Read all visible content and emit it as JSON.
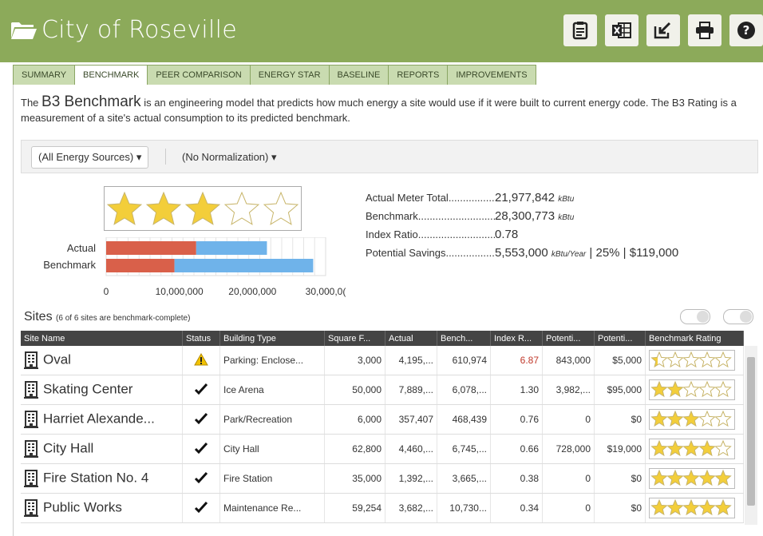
{
  "header": {
    "title": "City of Roseville",
    "buttons": [
      "notes-icon",
      "excel-icon",
      "export-icon",
      "print-icon",
      "help-icon"
    ]
  },
  "tabs": [
    "SUMMARY",
    "BENCHMARK",
    "PEER COMPARISON",
    "ENERGY STAR",
    "BASELINE",
    "REPORTS",
    "IMPROVEMENTS"
  ],
  "active_tab": "BENCHMARK",
  "intro": {
    "prefix": "The ",
    "emph": "B3 Benchmark",
    "text": " is an engineering model that predicts how much energy a site would use if it were built to current energy code. The B3 Rating is a measurement of a site's actual consumption to its predicted benchmark."
  },
  "filters": {
    "energy": "(All Energy Sources) ▾",
    "normalization": "(No Normalization) ▾"
  },
  "rating_stars": 3,
  "mini_chart": {
    "labels": [
      "Actual",
      "Benchmark"
    ],
    "ticks": [
      "0",
      "10,000,000",
      "20,000,000",
      "30,000,0("
    ],
    "actual": 21977842,
    "benchmark": 28300773,
    "colors": {
      "red": "#d9604a",
      "blue": "#6fb3ea"
    }
  },
  "stats": [
    {
      "label": "Actual Meter Total",
      "value": "21,977,842",
      "unit": "kBtu",
      "extra": ""
    },
    {
      "label": "Benchmark",
      "value": "28,300,773",
      "unit": "kBtu",
      "extra": ""
    },
    {
      "label": "Index Ratio",
      "value": "0.78",
      "unit": "",
      "extra": ""
    },
    {
      "label": "Potential Savings",
      "value": "5,553,000",
      "unit": "kBtu/Year",
      "extra": " | 25% | $119,000"
    }
  ],
  "sites": {
    "title": "Sites",
    "subtitle": "(6 of 6 sites are benchmark-complete)",
    "columns": [
      "Site Name",
      "Status",
      "Building Type",
      "Square F...",
      "Actual",
      "Bench...",
      "Index R...",
      "Potenti...",
      "Potenti...",
      "Benchmark Rating"
    ],
    "rows": [
      {
        "name": "Oval",
        "status": "warning",
        "type": "Parking: Enclose...",
        "sqft": "3,000",
        "actual": "4,195,...",
        "bench": "610,974",
        "index": "6.87",
        "pot_kbtu": "843,000",
        "pot_usd": "$5,000",
        "stars": 0.4,
        "highlight": true
      },
      {
        "name": "Skating Center",
        "status": "check",
        "type": "Ice Arena",
        "sqft": "50,000",
        "actual": "7,889,...",
        "bench": "6,078,...",
        "index": "1.30",
        "pot_kbtu": "3,982,...",
        "pot_usd": "$95,000",
        "stars": 2,
        "highlight": false
      },
      {
        "name": "Harriet Alexande...",
        "status": "check",
        "type": "Park/Recreation",
        "sqft": "6,000",
        "actual": "357,407",
        "bench": "468,439",
        "index": "0.76",
        "pot_kbtu": "0",
        "pot_usd": "$0",
        "stars": 3,
        "highlight": false
      },
      {
        "name": "City Hall",
        "status": "check",
        "type": "City Hall",
        "sqft": "62,800",
        "actual": "4,460,...",
        "bench": "6,745,...",
        "index": "0.66",
        "pot_kbtu": "728,000",
        "pot_usd": "$19,000",
        "stars": 4,
        "highlight": false
      },
      {
        "name": "Fire Station No. 4",
        "status": "check",
        "type": "Fire Station",
        "sqft": "35,000",
        "actual": "1,392,...",
        "bench": "3,665,...",
        "index": "0.38",
        "pot_kbtu": "0",
        "pot_usd": "$0",
        "stars": 5,
        "highlight": false
      },
      {
        "name": "Public Works",
        "status": "check",
        "type": "Maintenance Re...",
        "sqft": "59,254",
        "actual": "3,682,...",
        "bench": "10,730...",
        "index": "0.34",
        "pot_kbtu": "0",
        "pot_usd": "$0",
        "stars": 5,
        "highlight": false
      }
    ]
  }
}
